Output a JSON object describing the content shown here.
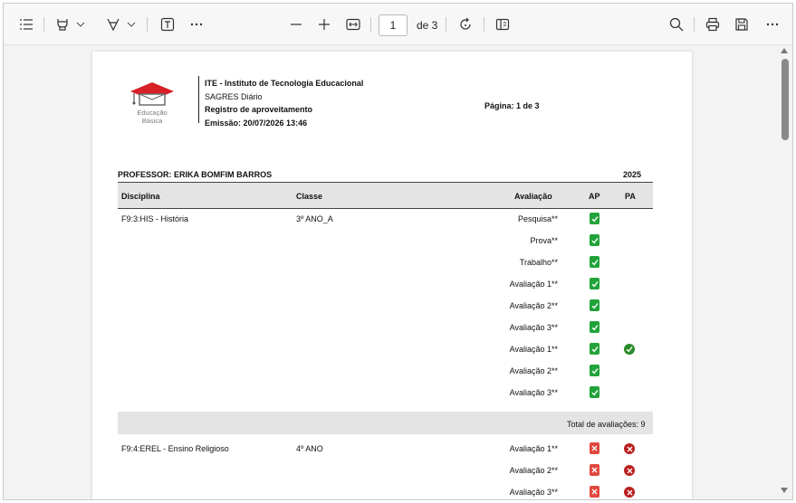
{
  "toolbar": {
    "page_current": "1",
    "page_of": "de 3"
  },
  "report": {
    "institution": "ITE - Instituto de Tecnologia Educacional",
    "system": "SAGRES Diário",
    "report_title": "Registro de aproveitamento",
    "emission": "Emissão: 20/07/2026 13:46",
    "page_label": "Página: 1 de 3",
    "logo_text_line1": "Educação",
    "logo_text_line2": "Básica",
    "professor": "PROFESSOR: ERIKA BOMFIM BARROS",
    "year": "2025",
    "headers": {
      "disciplina": "Disciplina",
      "classe": "Classe",
      "avaliacao": "Avaliação",
      "ap": "AP",
      "pa": "PA"
    },
    "groups": [
      {
        "disciplina": "F9:3:HIS - História",
        "classe": "3º ANO_A",
        "rows": [
          {
            "avaliacao": "Pesquisa**",
            "ap": "ok",
            "pa": ""
          },
          {
            "avaliacao": "Prova**",
            "ap": "ok",
            "pa": ""
          },
          {
            "avaliacao": "Trabalho**",
            "ap": "ok",
            "pa": ""
          },
          {
            "avaliacao": "Avaliação 1**",
            "ap": "ok",
            "pa": ""
          },
          {
            "avaliacao": "Avaliação 2**",
            "ap": "ok",
            "pa": ""
          },
          {
            "avaliacao": "Avaliação 3**",
            "ap": "ok",
            "pa": ""
          },
          {
            "avaliacao": "Avaliação 1**",
            "ap": "ok",
            "pa": "ok"
          },
          {
            "avaliacao": "Avaliação 2**",
            "ap": "ok",
            "pa": ""
          },
          {
            "avaliacao": "Avaliação 3**",
            "ap": "ok",
            "pa": ""
          }
        ],
        "total": "Total de avaliações: 9"
      },
      {
        "disciplina": "F9:4:EREL - Ensino Religioso",
        "classe": "4º ANO",
        "rows": [
          {
            "avaliacao": "Avaliação 1**",
            "ap": "bad",
            "pa": "bad"
          },
          {
            "avaliacao": "Avaliação 2**",
            "ap": "bad",
            "pa": "bad"
          },
          {
            "avaliacao": "Avaliação 3**",
            "ap": "bad",
            "pa": "bad"
          }
        ]
      }
    ]
  },
  "colors": {
    "check_ok": "#21a33a",
    "check_bad": "#e0483f",
    "circle_ok": "#2a8a2a",
    "circle_bad": "#b8201f"
  }
}
